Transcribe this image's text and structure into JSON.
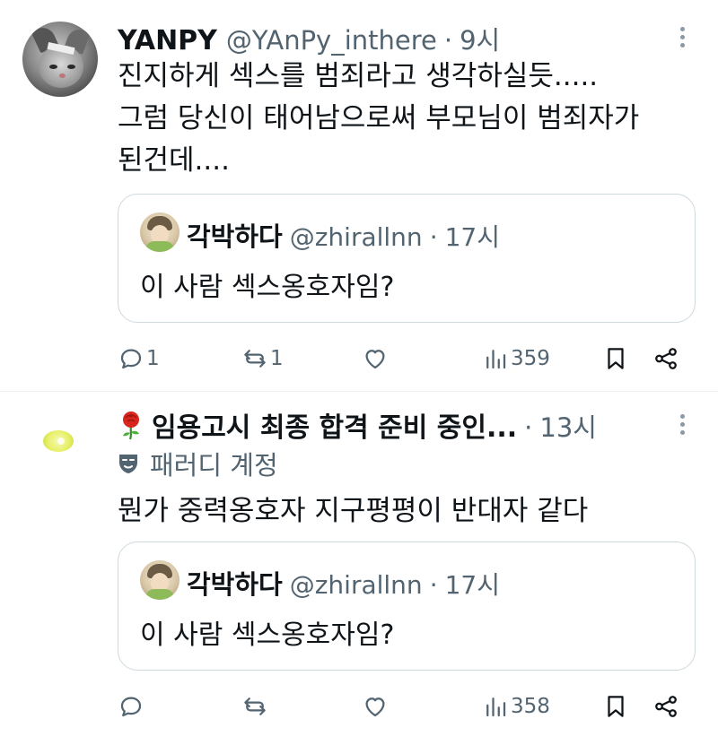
{
  "tweets": [
    {
      "display_name": "YANPY",
      "handle": "@YAnPy_inthere",
      "separator": "·",
      "time": "9시",
      "text_lines": [
        "진지하게 섹스를 범죄라고 생각하실듯.....",
        "그럼 당신이 태어남으로써 부모님이 범죄자가",
        "된건데...."
      ],
      "quote": {
        "display_name": "각박하다",
        "handle": "@zhirallnn",
        "separator": "·",
        "time": "17시",
        "text": "이 사람 섹스옹호자임?"
      },
      "actions": {
        "replies": "1",
        "retweets": "1",
        "likes": "",
        "views": "359"
      }
    },
    {
      "display_name": "임용고시 최종 합격 준비 중인...",
      "separator": "·",
      "time": "13시",
      "parody_label": "패러디 계정",
      "text_lines": [
        "뭔가 중력옹호자 지구평평이 반대자 같다"
      ],
      "quote": {
        "display_name": "각박하다",
        "handle": "@zhirallnn",
        "separator": "·",
        "time": "17시",
        "text": "이 사람 섹스옹호자임?"
      },
      "actions": {
        "replies": "",
        "retweets": "",
        "likes": "",
        "views": "358"
      }
    }
  ],
  "icons": {
    "reply": "reply-icon",
    "retweet": "retweet-icon",
    "like": "heart-icon",
    "views": "views-icon",
    "bookmark": "bookmark-icon",
    "share": "share-icon",
    "more": "more-icon",
    "rose": "rose-icon",
    "parody": "mask-icon"
  },
  "colors": {
    "text": "#0f1419",
    "secondary": "#536471",
    "border": "#cfd9de"
  }
}
